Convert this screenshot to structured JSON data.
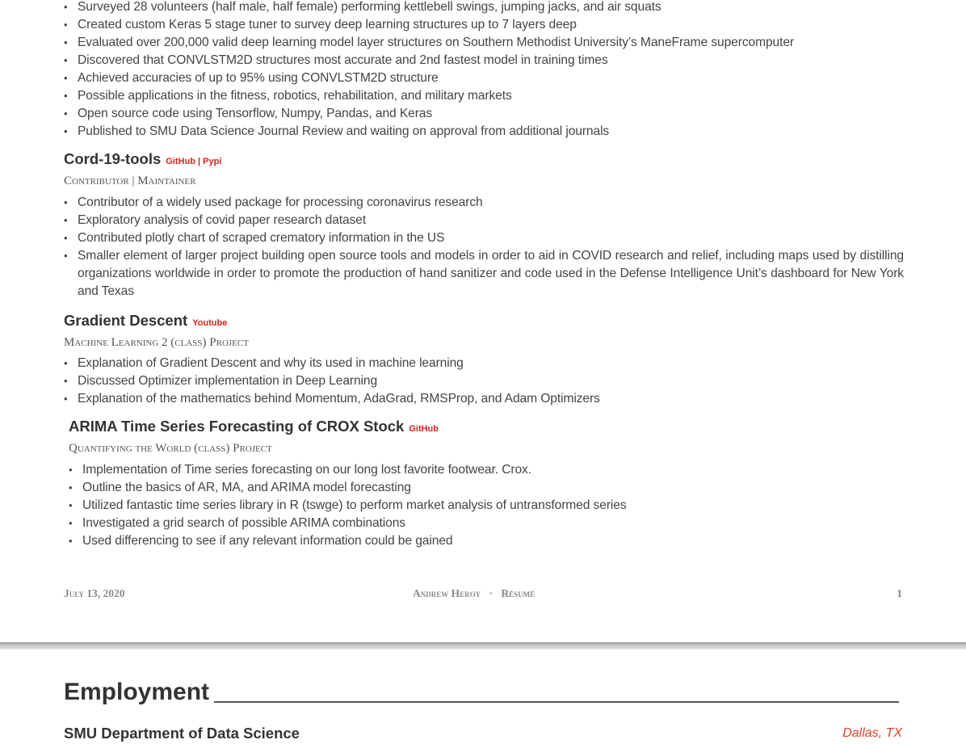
{
  "top_bullets": [
    "Surveyed 28 volunteers (half male, half female) performing kettlebell swings, jumping jacks, and air squats",
    "Created custom Keras 5 stage tuner to survey deep learning structures up to 7 layers deep",
    "Evaluated over 200,000 valid deep learning model layer structures on Southern Methodist University’s ManeFrame supercomputer",
    "Discovered that CONVLSTM2D structures most accurate and 2nd fastest model in training times",
    "Achieved accuracies of up to 95% using CONVLSTM2D structure",
    "Possible applications in the fitness, robotics, rehabilitation, and military markets",
    "Open source code using Tensorflow, Numpy, Pandas, and Keras",
    "Published to SMU Data Science Journal Review and waiting on approval from additional journals"
  ],
  "projects": [
    {
      "title": "Cord-19-tools",
      "links": [
        "GitHub",
        "Pypi"
      ],
      "role": "Contributor | Maintainer",
      "bullets": [
        "Contributor of a widely used package for processing coronavirus research",
        "Exploratory analysis of covid paper research dataset",
        "Contributed plotly chart of scraped crematory information in the US",
        "Smaller element of larger project building open source tools and models in order to aid in COVID research and relief, including maps used by distilling organizations worldwide in order to promote the production of hand sanitizer and code used in the Defense Intelligence Unit’s dashboard for New York and Texas"
      ]
    },
    {
      "title": "Gradient Descent",
      "links": [
        "Youtube"
      ],
      "role": "Machine Learning 2 (class) Project",
      "bullets": [
        "Explanation of Gradient Descent and why its used in machine learning",
        "Discussed Optimizer implementation in Deep Learning",
        "Explanation of the mathematics behind Momentum, AdaGrad, RMSProp, and Adam Optimizers"
      ]
    },
    {
      "title": "ARIMA Time Series Forecasting of CROX Stock",
      "links": [
        "GitHub"
      ],
      "role": "Quantifying the World (class) Project",
      "bullets": [
        "Implementation of Time series forecasting on our long lost favorite footwear. Crox.",
        "Outline the basics of AR, MA, and ARIMA model forecasting",
        "Utilized fantastic time series library in R (tswge) to perform market analysis of untransformed series",
        "Investigated a grid search of possible ARIMA combinations",
        "Used differencing to see if any relevant information could be gained"
      ]
    }
  ],
  "footer": {
    "date": "July 13, 2020",
    "author": "Andrew Heroy",
    "separator": "·",
    "doc": "Résumé",
    "page_number": "1"
  },
  "next_page": {
    "section_title": "Employment",
    "employer": "SMU Department of Data Science",
    "location": "Dallas, TX"
  },
  "colors": {
    "link_red": "#e02020",
    "location_orange": "#e0401e",
    "heading": "#333333",
    "body_text": "#444444"
  }
}
